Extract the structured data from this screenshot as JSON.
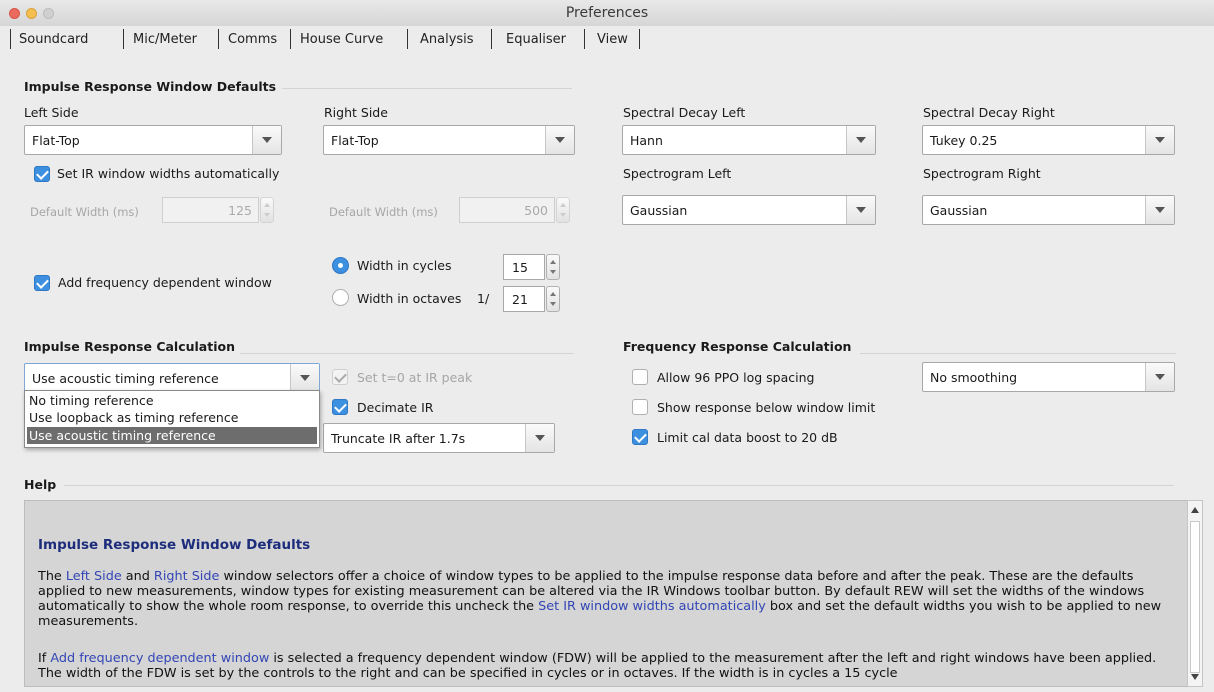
{
  "window": {
    "title": "Preferences",
    "colors": {
      "close": "#ed6a5e",
      "minimize": "#f5bf4f",
      "zoom": "#d0d0d0",
      "accent": "#3d8fe0",
      "help_heading": "#1d2d7c",
      "link": "#3245b5"
    }
  },
  "tabs": [
    "Soundcard",
    "Mic/Meter",
    "Comms",
    "House Curve",
    "Analysis",
    "Equaliser",
    "View"
  ],
  "selected_tab": "Analysis",
  "irwd": {
    "title": "Impulse Response Window Defaults",
    "left_label": "Left Side",
    "left_value": "Flat-Top",
    "right_label": "Right Side",
    "right_value": "Flat-Top",
    "sdl_label": "Spectral Decay Left",
    "sdl_value": "Hann",
    "sdr_label": "Spectral Decay Right",
    "sdr_value": "Tukey 0.25",
    "sgl_label": "Spectrogram Left",
    "sgl_value": "Gaussian",
    "sgr_label": "Spectrogram Right",
    "sgr_value": "Gaussian",
    "auto_width_label": "Set IR window widths automatically",
    "auto_width_checked": true,
    "default_width_label": "Default Width (ms)",
    "left_width": "125",
    "right_width": "500",
    "fdw_label": "Add frequency dependent window",
    "fdw_checked": true,
    "cycles_label": "Width in cycles",
    "cycles_value": "15",
    "cycles_selected": true,
    "octaves_label": "Width in octaves",
    "octaves_prefix": "1/",
    "octaves_value": "21"
  },
  "irc": {
    "title": "Impulse Response Calculation",
    "timing_value": "Use acoustic timing reference",
    "timing_options": [
      "No timing reference",
      "Use loopback as timing reference",
      "Use acoustic timing reference"
    ],
    "t0_label": "Set t=0 at IR peak",
    "t0_checked": true,
    "t0_enabled": false,
    "decimate_label": "Decimate IR",
    "decimate_checked": true,
    "truncate_value": "Truncate IR after 1.7s"
  },
  "frc": {
    "title": "Frequency Response Calculation",
    "ppo_label": "Allow 96 PPO log spacing",
    "ppo_checked": false,
    "below_label": "Show response below window limit",
    "below_checked": false,
    "cal_label": "Limit cal data boost to 20 dB",
    "cal_checked": true,
    "smoothing_value": "No smoothing"
  },
  "help": {
    "title": "Help",
    "heading": "Impulse Response Window Defaults",
    "p1": {
      "a": "The ",
      "b": "Left Side",
      "c": " and ",
      "d": "Right Side",
      "e": " window selectors offer a choice of window types to be applied to the impulse response data before and after the peak. These are the defaults applied to new measurements, window types for existing measurement can be altered via the IR Windows toolbar button. By default REW will set the widths of the windows automatically to show the whole room response, to override this uncheck the ",
      "f": "Set IR window widths automatically",
      "g": " box and set the default widths you wish to be applied to new measurements."
    },
    "p2": {
      "a": "If ",
      "b": "Add frequency dependent window",
      "c": " is selected a frequency dependent window (FDW) will be applied to the measurement after the left and right windows have been applied. The width of the FDW is set by the controls to the right and can be specified in cycles or in octaves. If the width is in cycles a 15 cycle"
    }
  }
}
